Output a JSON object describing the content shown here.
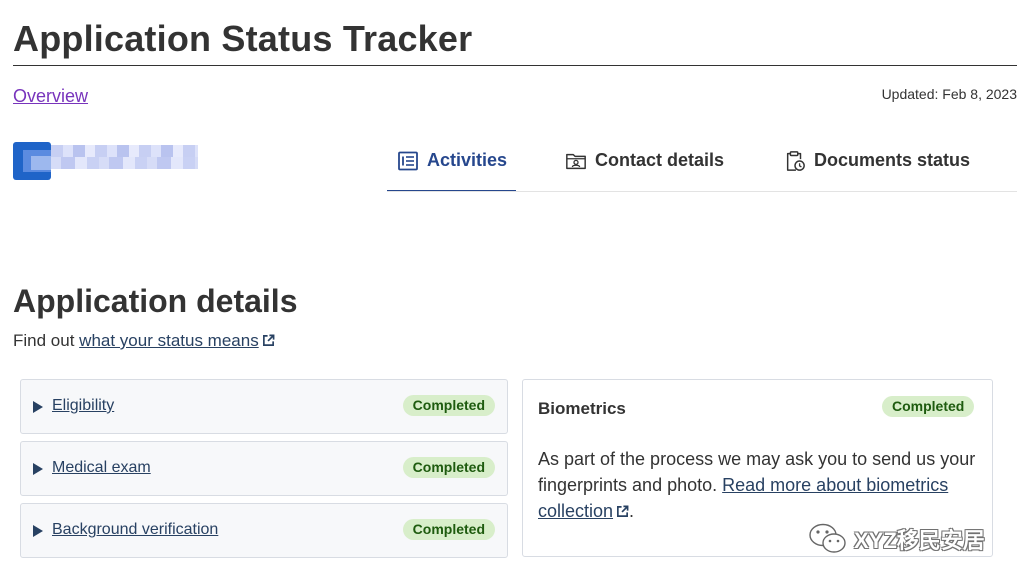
{
  "header": {
    "title": "Application Status Tracker",
    "overview_link": "Overview",
    "updated": "Updated: Feb 8, 2023"
  },
  "tabs": [
    {
      "label": "Activities",
      "icon": "list-icon",
      "active": true
    },
    {
      "label": "Contact details",
      "icon": "folder-contact-icon",
      "active": false
    },
    {
      "label": "Documents status",
      "icon": "clipboard-clock-icon",
      "active": false
    }
  ],
  "details": {
    "title": "Application details",
    "find_out_prefix": "Find out",
    "find_out_link": "what your status means",
    "items": [
      {
        "label": "Eligibility",
        "status": "Completed"
      },
      {
        "label": "Medical exam",
        "status": "Completed"
      },
      {
        "label": "Background verification",
        "status": "Completed"
      }
    ],
    "biometrics": {
      "title": "Biometrics",
      "status": "Completed",
      "text": "As part of the process we may ask you to send us your fingerprints and photo.",
      "link": "Read more about biometrics collection",
      "suffix": "."
    }
  },
  "watermark": "XYZ移民安居",
  "colors": {
    "accent": "#26478d",
    "link": "#284162",
    "visited": "#7834bc",
    "badge_bg": "#d8eeca",
    "badge_text": "#1e5b0f",
    "avatar": "#1f64c8"
  }
}
